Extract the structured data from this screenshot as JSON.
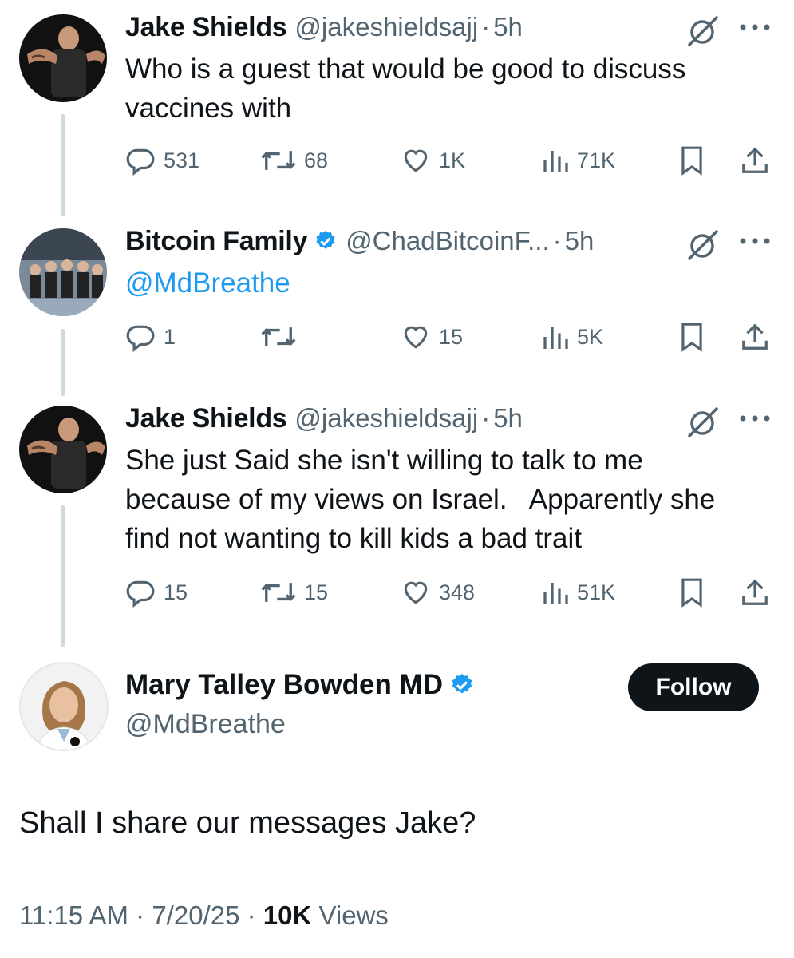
{
  "tweets": [
    {
      "name": "Jake Shields",
      "handle": "@jakeshieldsajj",
      "separator": "·",
      "time": "5h",
      "verified": false,
      "text": "Who is a guest that would be good to discuss vaccines with",
      "mention": "",
      "stats": {
        "replies": "531",
        "reposts": "68",
        "likes": "1K",
        "views": "71K"
      }
    },
    {
      "name": "Bitcoin Family",
      "handle": "@ChadBitcoinF...",
      "separator": "·",
      "time": "5h",
      "verified": true,
      "text": "",
      "mention": "@MdBreathe",
      "stats": {
        "replies": "1",
        "reposts": "",
        "likes": "15",
        "views": "5K"
      }
    },
    {
      "name": "Jake Shields",
      "handle": "@jakeshieldsajj",
      "separator": "·",
      "time": "5h",
      "verified": false,
      "text": "She just Said she isn't willing to talk to me because of my views on Israel.   Apparently she find not wanting to kill kids a bad trait",
      "mention": "",
      "stats": {
        "replies": "15",
        "reposts": "15",
        "likes": "348",
        "views": "51K"
      }
    }
  ],
  "main_tweet": {
    "name": "Mary Talley Bowden MD",
    "handle": "@MdBreathe",
    "follow_label": "Follow",
    "text": "Shall I share our messages Jake?",
    "time": "11:15 AM",
    "date": "7/20/25",
    "separator": "·",
    "views_count": "10K",
    "views_label": "Views"
  },
  "icons": [
    "reply-icon",
    "repost-icon",
    "like-icon",
    "views-icon",
    "bookmark-icon",
    "share-icon",
    "grok-icon",
    "more-icon",
    "verified-icon"
  ],
  "colors": {
    "accent": "#1d9bf0",
    "text": "#0f1419",
    "secondary": "#536471",
    "thread_line": "#cfd9de"
  }
}
